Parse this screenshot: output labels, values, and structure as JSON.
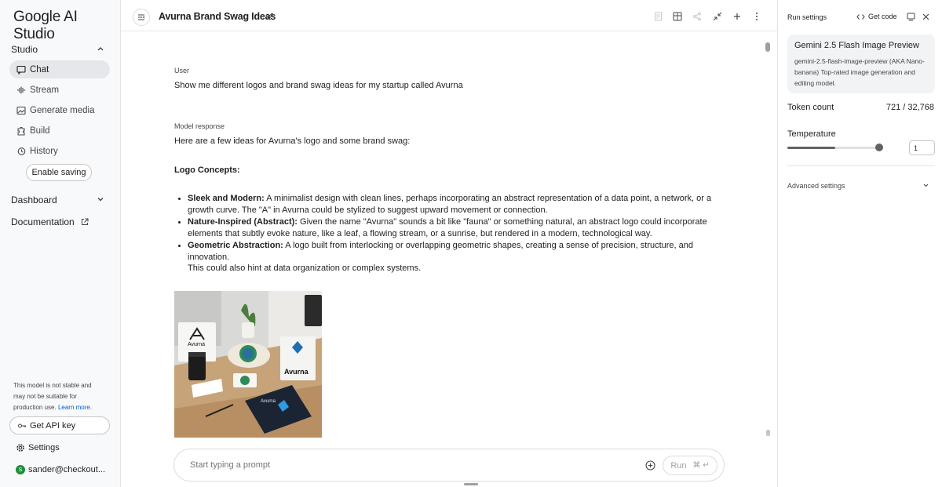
{
  "sidebar": {
    "brand": "Google AI Studio",
    "studio_label": "Studio",
    "items": [
      {
        "label": "Chat",
        "icon": "chat-icon",
        "active": true
      },
      {
        "label": "Stream",
        "icon": "stream-icon"
      },
      {
        "label": "Generate media",
        "icon": "media-icon"
      },
      {
        "label": "Build",
        "icon": "build-icon"
      },
      {
        "label": "History",
        "icon": "history-icon"
      }
    ],
    "enable_saving": "Enable saving",
    "dashboard_label": "Dashboard",
    "documentation_label": "Documentation",
    "note_text": "This model is not stable and may not be suitable for production use.",
    "note_link": "Learn more.",
    "get_api_key": "Get API key",
    "settings": "Settings",
    "user": "sander@checkout..."
  },
  "header": {
    "title": "Avurna Brand Swag Ideas"
  },
  "chat": {
    "user_role": "User",
    "user_message": "Show me different logos and brand swag ideas for my startup called Avurna",
    "model_role": "Model response",
    "intro": "Here are a few ideas for Avurna's logo and some brand swag:",
    "section_heading": "Logo Concepts:",
    "bullets": [
      {
        "title": "Sleek and Modern:",
        "line1": " A minimalist design with clean lines, perhaps incorporating an abstract representation of a data point, a network, or a",
        "line2": "growth curve. The \"A\" in Avurna could be stylized to suggest upward movement or connection."
      },
      {
        "title": "Nature-Inspired (Abstract):",
        "line1": " Given the name \"Avurna\" sounds a bit like \"fauna\" or something natural, an abstract logo could incorporate",
        "line2": "elements that subtly evoke nature, like a leaf, a flowing stream, or a sunrise, but rendered in a modern, technological way."
      },
      {
        "title": "Geometric Abstraction:",
        "line1": " A logo built from interlocking or overlapping geometric shapes, creating a sense of precision, structure, and innovation.",
        "line2": "This could also hint at data organization or complex systems."
      }
    ],
    "image_label_1": "Avurna",
    "image_label_2": "Avurna",
    "image_label_3": "Avurna",
    "prompt_placeholder": "Start typing a prompt",
    "run_label": "Run",
    "run_shortcut": "⌘ ↵"
  },
  "run_settings": {
    "title": "Run settings",
    "get_code": "Get code",
    "model_name": "Gemini 2.5 Flash Image Preview",
    "model_desc": "gemini-2.5-flash-image-preview (AKA Nano-banana) Top-rated image generation and editing model.",
    "token_label": "Token count",
    "token_value": "721 / 32,768",
    "temperature_label": "Temperature",
    "temperature_value": "1",
    "temperature_level": 0.5,
    "advanced_label": "Advanced settings"
  }
}
